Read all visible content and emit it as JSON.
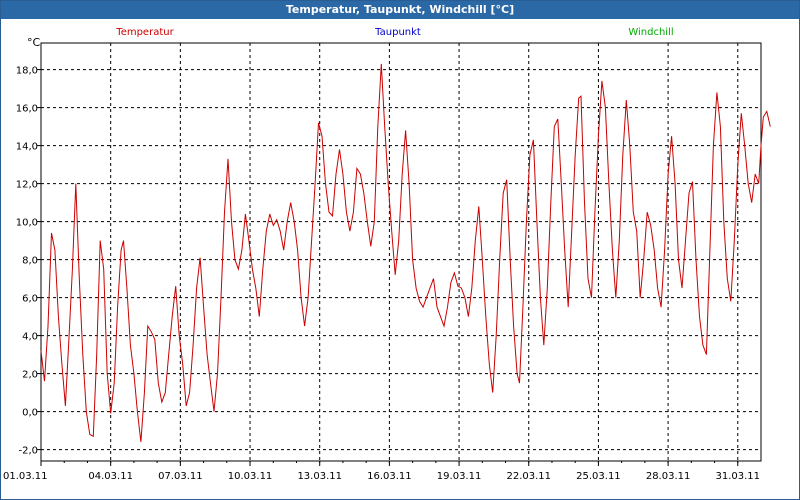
{
  "window": {
    "title": "Temperatur, Taupunkt, Windchill [°C]"
  },
  "chart_data": {
    "type": "line",
    "title": "Temperatur, Taupunkt, Windchill [°C]",
    "ylabel": "°C",
    "xlabel": "",
    "ylim": [
      -2.6,
      19.4
    ],
    "grid": true,
    "legend_position": "top",
    "colors": {
      "Temperatur": "#cc0000",
      "Taupunkt": "#0000cc",
      "Windchill": "#00aa00"
    },
    "y_ticks": [
      "-2,0",
      "0,0",
      "2,0",
      "4,0",
      "6,0",
      "8,0",
      "10,0",
      "12,0",
      "14,0",
      "16,0",
      "18,0"
    ],
    "y_tick_values": [
      -2,
      0,
      2,
      4,
      6,
      8,
      10,
      12,
      14,
      16,
      18
    ],
    "x_ticks": [
      "01.03.11",
      "04.03.11",
      "07.03.11",
      "10.03.11",
      "13.03.11",
      "16.03.11",
      "19.03.11",
      "22.03.11",
      "25.03.11",
      "28.03.11",
      "31.03.11"
    ],
    "x_tick_days": [
      0,
      3,
      6,
      9,
      12,
      15,
      18,
      21,
      24,
      27,
      30
    ],
    "x_range_days": [
      0,
      31
    ],
    "series": [
      {
        "name": "Temperatur",
        "points": [
          [
            0.0,
            3.2
          ],
          [
            0.15,
            1.6
          ],
          [
            0.3,
            4.5
          ],
          [
            0.45,
            9.4
          ],
          [
            0.6,
            8.5
          ],
          [
            0.75,
            5.0
          ],
          [
            0.9,
            2.5
          ],
          [
            1.05,
            0.3
          ],
          [
            1.2,
            3.8
          ],
          [
            1.35,
            7.5
          ],
          [
            1.5,
            12.0
          ],
          [
            1.65,
            7.0
          ],
          [
            1.8,
            3.0
          ],
          [
            1.95,
            0.0
          ],
          [
            2.1,
            -1.2
          ],
          [
            2.25,
            -1.3
          ],
          [
            2.4,
            3.0
          ],
          [
            2.55,
            9.0
          ],
          [
            2.7,
            7.5
          ],
          [
            2.85,
            2.0
          ],
          [
            3.0,
            -0.1
          ],
          [
            3.15,
            1.5
          ],
          [
            3.3,
            5.5
          ],
          [
            3.45,
            8.5
          ],
          [
            3.55,
            9.0
          ],
          [
            3.7,
            6.5
          ],
          [
            3.85,
            3.5
          ],
          [
            4.0,
            2.0
          ],
          [
            4.15,
            0.0
          ],
          [
            4.3,
            -1.6
          ],
          [
            4.45,
            1.0
          ],
          [
            4.6,
            4.5
          ],
          [
            4.75,
            4.2
          ],
          [
            4.9,
            3.8
          ],
          [
            5.05,
            1.5
          ],
          [
            5.2,
            0.5
          ],
          [
            5.35,
            1.0
          ],
          [
            5.5,
            3.0
          ],
          [
            5.65,
            5.0
          ],
          [
            5.8,
            6.6
          ],
          [
            5.95,
            4.0
          ],
          [
            6.1,
            2.5
          ],
          [
            6.25,
            0.3
          ],
          [
            6.4,
            1.0
          ],
          [
            6.55,
            3.5
          ],
          [
            6.7,
            6.5
          ],
          [
            6.85,
            8.1
          ],
          [
            7.0,
            5.5
          ],
          [
            7.15,
            3.0
          ],
          [
            7.3,
            1.5
          ],
          [
            7.45,
            0.0
          ],
          [
            7.6,
            2.0
          ],
          [
            7.75,
            6.0
          ],
          [
            7.9,
            10.5
          ],
          [
            8.05,
            13.3
          ],
          [
            8.2,
            10.0
          ],
          [
            8.35,
            8.0
          ],
          [
            8.5,
            7.5
          ],
          [
            8.65,
            8.5
          ],
          [
            8.8,
            10.4
          ],
          [
            8.95,
            9.0
          ],
          [
            9.1,
            7.5
          ],
          [
            9.25,
            6.5
          ],
          [
            9.4,
            5.0
          ],
          [
            9.55,
            7.5
          ],
          [
            9.7,
            9.5
          ],
          [
            9.85,
            10.4
          ],
          [
            10.0,
            9.8
          ],
          [
            10.15,
            10.1
          ],
          [
            10.3,
            9.5
          ],
          [
            10.45,
            8.5
          ],
          [
            10.6,
            10.0
          ],
          [
            10.75,
            11.0
          ],
          [
            10.9,
            10.0
          ],
          [
            11.05,
            8.5
          ],
          [
            11.2,
            6.0
          ],
          [
            11.35,
            4.5
          ],
          [
            11.5,
            6.0
          ],
          [
            11.65,
            9.0
          ],
          [
            11.8,
            12.0
          ],
          [
            11.95,
            15.2
          ],
          [
            12.1,
            14.5
          ],
          [
            12.25,
            12.0
          ],
          [
            12.4,
            10.5
          ],
          [
            12.55,
            10.3
          ],
          [
            12.7,
            12.5
          ],
          [
            12.85,
            13.8
          ],
          [
            13.0,
            12.5
          ],
          [
            13.15,
            10.5
          ],
          [
            13.3,
            9.5
          ],
          [
            13.45,
            10.5
          ],
          [
            13.6,
            12.8
          ],
          [
            13.75,
            12.5
          ],
          [
            13.9,
            11.5
          ],
          [
            14.05,
            10.0
          ],
          [
            14.2,
            8.7
          ],
          [
            14.35,
            10.0
          ],
          [
            14.5,
            15.0
          ],
          [
            14.65,
            18.3
          ],
          [
            14.8,
            15.0
          ],
          [
            14.95,
            12.0
          ],
          [
            15.1,
            9.5
          ],
          [
            15.25,
            7.2
          ],
          [
            15.4,
            9.0
          ],
          [
            15.55,
            12.5
          ],
          [
            15.7,
            14.8
          ],
          [
            15.85,
            12.0
          ],
          [
            16.0,
            8.0
          ],
          [
            16.15,
            6.5
          ],
          [
            16.3,
            5.8
          ],
          [
            16.45,
            5.5
          ],
          [
            16.6,
            6.0
          ],
          [
            16.75,
            6.5
          ],
          [
            16.9,
            7.0
          ],
          [
            17.05,
            5.5
          ],
          [
            17.2,
            5.0
          ],
          [
            17.35,
            4.5
          ],
          [
            17.5,
            5.5
          ],
          [
            17.65,
            6.8
          ],
          [
            17.8,
            7.3
          ],
          [
            17.95,
            6.6
          ],
          [
            18.1,
            6.5
          ],
          [
            18.25,
            6.0
          ],
          [
            18.4,
            5.0
          ],
          [
            18.55,
            6.5
          ],
          [
            18.7,
            9.0
          ],
          [
            18.85,
            10.8
          ],
          [
            19.0,
            8.0
          ],
          [
            19.15,
            5.0
          ],
          [
            19.3,
            2.5
          ],
          [
            19.45,
            1.0
          ],
          [
            19.6,
            4.0
          ],
          [
            19.75,
            8.0
          ],
          [
            19.9,
            11.5
          ],
          [
            20.05,
            12.2
          ],
          [
            20.2,
            8.0
          ],
          [
            20.35,
            4.5
          ],
          [
            20.5,
            2.0
          ],
          [
            20.6,
            1.5
          ],
          [
            20.75,
            5.5
          ],
          [
            20.9,
            10.0
          ],
          [
            21.05,
            13.5
          ],
          [
            21.2,
            14.3
          ],
          [
            21.35,
            10.0
          ],
          [
            21.5,
            6.0
          ],
          [
            21.65,
            3.5
          ],
          [
            21.8,
            6.5
          ],
          [
            21.95,
            11.0
          ],
          [
            22.1,
            15.0
          ],
          [
            22.25,
            15.4
          ],
          [
            22.4,
            12.0
          ],
          [
            22.55,
            8.5
          ],
          [
            22.7,
            5.5
          ],
          [
            22.85,
            9.5
          ],
          [
            23.0,
            13.5
          ],
          [
            23.15,
            16.5
          ],
          [
            23.25,
            16.6
          ],
          [
            23.4,
            11.0
          ],
          [
            23.55,
            7.0
          ],
          [
            23.7,
            6.0
          ],
          [
            23.85,
            10.5
          ],
          [
            24.0,
            14.5
          ],
          [
            24.15,
            17.4
          ],
          [
            24.3,
            16.0
          ],
          [
            24.45,
            12.0
          ],
          [
            24.6,
            8.5
          ],
          [
            24.75,
            6.0
          ],
          [
            24.9,
            9.0
          ],
          [
            25.05,
            13.5
          ],
          [
            25.2,
            16.4
          ],
          [
            25.35,
            14.0
          ],
          [
            25.5,
            10.5
          ],
          [
            25.65,
            9.5
          ],
          [
            25.8,
            6.0
          ],
          [
            25.95,
            8.0
          ],
          [
            26.1,
            10.5
          ],
          [
            26.25,
            9.8
          ],
          [
            26.4,
            8.5
          ],
          [
            26.55,
            6.5
          ],
          [
            26.7,
            5.5
          ],
          [
            26.85,
            8.5
          ],
          [
            27.0,
            12.5
          ],
          [
            27.15,
            14.5
          ],
          [
            27.3,
            12.0
          ],
          [
            27.45,
            8.0
          ],
          [
            27.6,
            6.5
          ],
          [
            27.75,
            9.0
          ],
          [
            27.9,
            11.5
          ],
          [
            28.05,
            12.1
          ],
          [
            28.2,
            8.0
          ],
          [
            28.35,
            5.0
          ],
          [
            28.5,
            3.5
          ],
          [
            28.65,
            3.0
          ],
          [
            28.8,
            8.5
          ],
          [
            28.95,
            14.0
          ],
          [
            29.1,
            16.8
          ],
          [
            29.25,
            15.0
          ],
          [
            29.4,
            10.0
          ],
          [
            29.55,
            7.0
          ],
          [
            29.7,
            5.8
          ],
          [
            29.85,
            9.0
          ],
          [
            30.0,
            13.0
          ],
          [
            30.15,
            15.7
          ],
          [
            30.3,
            14.0
          ],
          [
            30.45,
            12.0
          ],
          [
            30.6,
            11.0
          ],
          [
            30.75,
            12.5
          ],
          [
            30.9,
            12.0
          ],
          [
            31.0,
            14.0
          ],
          [
            31.1,
            15.5
          ],
          [
            31.25,
            15.8
          ],
          [
            31.4,
            15.0
          ]
        ]
      },
      {
        "name": "Taupunkt",
        "points": []
      },
      {
        "name": "Windchill",
        "points": []
      }
    ]
  }
}
